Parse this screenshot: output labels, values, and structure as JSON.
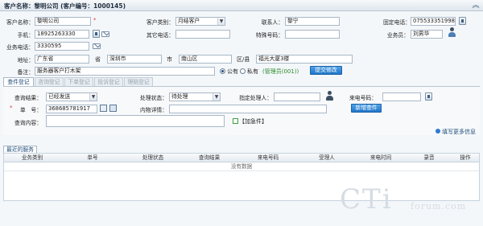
{
  "header": {
    "title": "客户名称：黎明公司 (客户编号：1000145)"
  },
  "customer": {
    "name_label": "客户名称：",
    "name_value": "黎明公司",
    "name_required": "*",
    "type_label": "客户类别：",
    "type_value": "月结客户",
    "contact_label": "联系人：",
    "contact_value": "黎宁",
    "landline_label": "固定电话：",
    "landline_value": "075533351998",
    "mobile_label": "手机：",
    "mobile_value": "18925263330",
    "other_phone_label": "其它电话：",
    "other_phone_value": "",
    "special_no_label": "特殊号码：",
    "special_no_value": "",
    "salesman_label": "业务员：",
    "salesman_value": "刘男华",
    "biz_phone_label": "业务电话：",
    "biz_phone_value": "3330595",
    "address_label": "地址：",
    "province_value": "广东省",
    "province_unit": "省",
    "city_value": "深圳市",
    "city_unit": "市",
    "district_value": "南山区",
    "district_unit": "区/县",
    "street_value": "福光大厦3楼",
    "remark_label": "备注：",
    "remark_value": "服务器客户打木架",
    "public_label": "公有",
    "private_label": "私有",
    "owner_text": "(管理员(001))",
    "submit_label": "提交修改"
  },
  "tabs": [
    "查件登记",
    "咨询登记",
    "下单登记",
    "投诉登记",
    "理赔登记"
  ],
  "inquiry": {
    "result_label": "查询结果：",
    "result_value": "已经发送",
    "status_label": "处理状态：",
    "status_value": "待处理",
    "handler_label": "指定处理人：",
    "handler_value": "",
    "caller_label": "来电号码：",
    "caller_value": "",
    "order_label": "单　号：",
    "order_required": "*",
    "order_value": "368685781917",
    "detail_label": "内物详情：",
    "detail_value": "",
    "content_label": "查询内容：",
    "content_value": "",
    "urgent_label": "【加急件】",
    "add_button": "新增查件",
    "more_link": "填写更多信息"
  },
  "recent": {
    "tab_label": "最近的服务",
    "columns": [
      "业务类别",
      "单号",
      "处理状态",
      "查询结果",
      "来电号码",
      "受理人",
      "来电时间",
      "录音",
      "操作"
    ],
    "empty_text": "没有数据"
  },
  "watermark": {
    "main": "CTi",
    "sub": "forum.com"
  }
}
